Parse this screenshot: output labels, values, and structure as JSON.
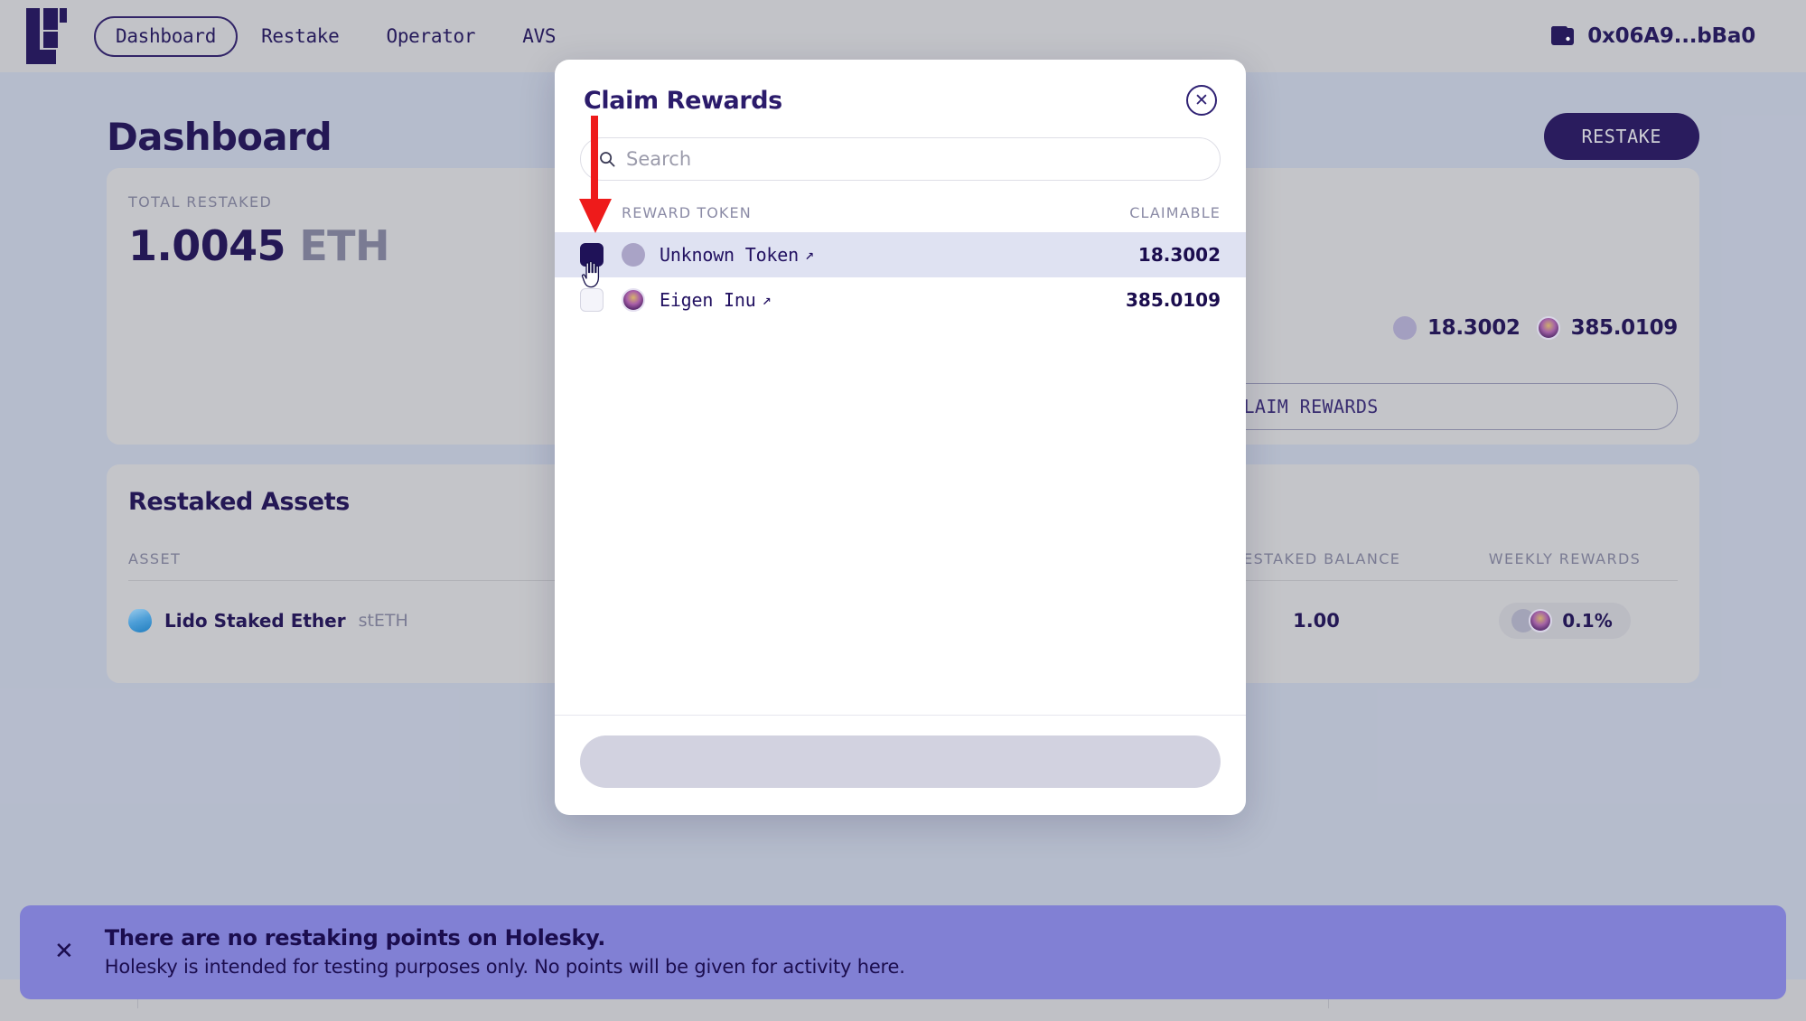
{
  "navbar": {
    "logo_name": "logo-mark",
    "links": [
      {
        "label": "Dashboard",
        "active": true
      },
      {
        "label": "Restake",
        "active": false
      },
      {
        "label": "Operator",
        "active": false
      },
      {
        "label": "AVS",
        "active": false
      }
    ],
    "wallet": {
      "icon": "wallet-icon",
      "address": "0x06A9...bBa0"
    }
  },
  "page": {
    "title": "Dashboard",
    "restake_button": "RESTAKE"
  },
  "total_card": {
    "label": "TOTAL  RESTAKED",
    "amount": "1.0045",
    "unit": "ETH",
    "rewards": [
      {
        "icon": "unknown-token-icon",
        "amount": "18.3002"
      },
      {
        "icon": "eigen-inu-token-icon",
        "amount": "385.0109"
      }
    ],
    "claim_button": "CLAIM REWARDS"
  },
  "assets_card": {
    "title": "Restaked Assets",
    "columns": [
      "ASSET",
      "RESTAKED BALANCE",
      "WEEKLY REWARDS"
    ],
    "rows": [
      {
        "icon": "lido-token-icon",
        "name": "Lido Staked Ether",
        "symbol": "stETH",
        "balance": "1.00",
        "weekly_icon": "eigen-inu-token-icon",
        "weekly": "0.1%"
      }
    ]
  },
  "modal": {
    "title": "Claim Rewards",
    "close_icon": "close-icon",
    "search": {
      "icon": "search-icon",
      "value": "",
      "placeholder": "Search"
    },
    "columns": {
      "token": "REWARD TOKEN",
      "claimable": "CLAIMABLE"
    },
    "rows": [
      {
        "checked": true,
        "icon": "unknown-token-icon",
        "name": "Unknown Token",
        "external_icon": "external-link-icon",
        "claimable": "18.3002"
      },
      {
        "checked": false,
        "icon": "eigen-inu-token-icon",
        "name": "Eigen Inu",
        "external_icon": "external-link-icon",
        "claimable": "385.0109"
      }
    ],
    "submit_label": ""
  },
  "banner": {
    "close_icon": "close-icon",
    "title": "There are no restaking points on Holesky.",
    "body": "Holesky is intended for testing purposes only. No points will be given for activity here."
  },
  "annotation": {
    "arrow": "red-down-arrow",
    "cursor": "hand-cursor"
  },
  "colors": {
    "brand_navy": "#1f1258",
    "page_bg": "#bdc3d3",
    "nav_bg": "#cbcbce",
    "card_bg": "#cdcdd0",
    "banner_bg": "#8180d4",
    "row_selected": "#dfe2f2",
    "annotation_red": "#ee1b1b"
  }
}
